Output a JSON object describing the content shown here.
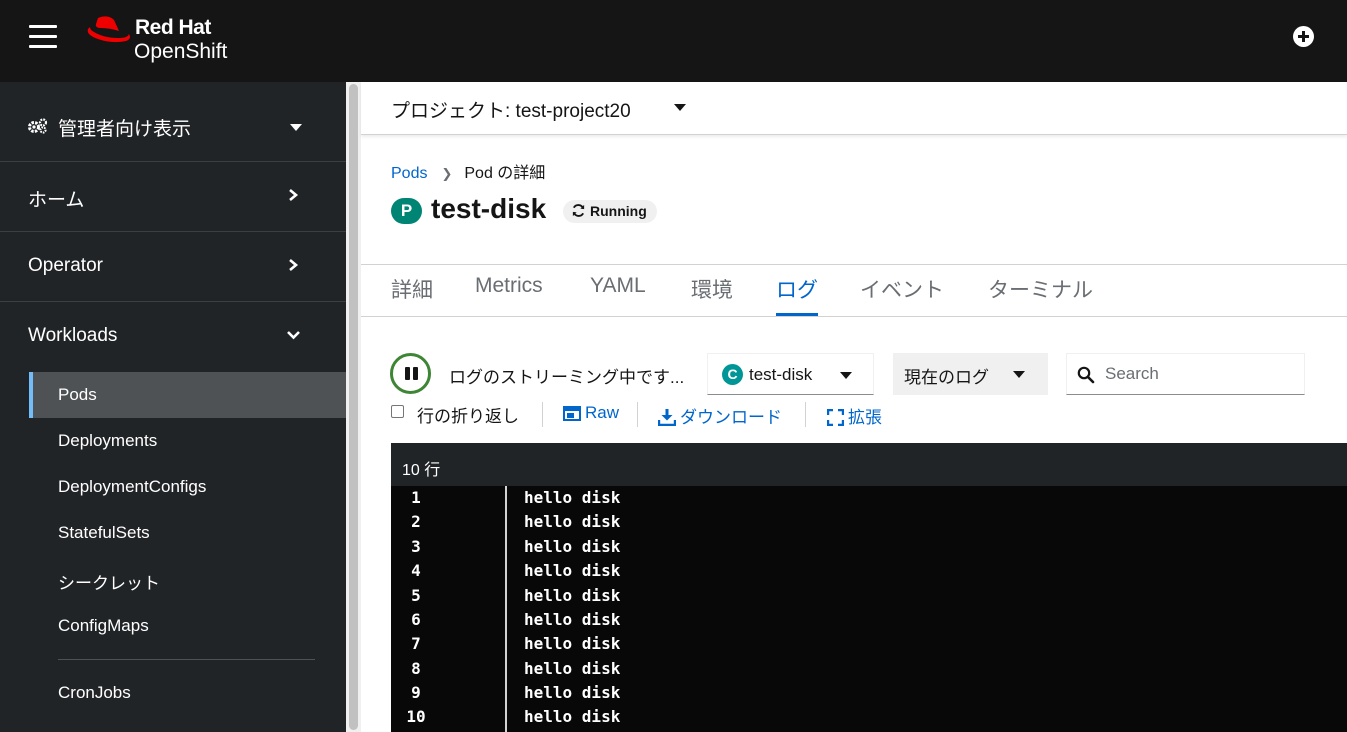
{
  "masthead": {
    "brand_line1": "Red Hat",
    "brand_line2": "OpenShift"
  },
  "sidebar": {
    "perspective": "管理者向け表示",
    "sections": [
      {
        "label": "ホーム"
      },
      {
        "label": "Operator"
      },
      {
        "label": "Workloads"
      }
    ],
    "workloads_items": [
      {
        "label": "Pods",
        "active": true
      },
      {
        "label": "Deployments"
      },
      {
        "label": "DeploymentConfigs"
      },
      {
        "label": "StatefulSets"
      },
      {
        "label": "シークレット"
      },
      {
        "label": "ConfigMaps"
      },
      {
        "label": "CronJobs"
      }
    ]
  },
  "project": {
    "label": "プロジェクト: test-project20"
  },
  "breadcrumb": {
    "parent": "Pods",
    "current": "Pod の詳細"
  },
  "pod": {
    "badge": "P",
    "name": "test-disk",
    "status": "Running"
  },
  "tabs": [
    {
      "label": "詳細"
    },
    {
      "label": "Metrics"
    },
    {
      "label": "YAML"
    },
    {
      "label": "環境"
    },
    {
      "label": "ログ",
      "active": true
    },
    {
      "label": "イベント"
    },
    {
      "label": "ターミナル"
    }
  ],
  "log_toolbar": {
    "streaming_text": "ログのストリーミング中です...",
    "container_badge": "C",
    "container": "test-disk",
    "log_type": "現在のログ",
    "search_placeholder": "Search",
    "wrap_label": "行の折り返し",
    "raw_label": "Raw",
    "download_label": "ダウンロード",
    "expand_label": "拡張"
  },
  "log_viewer": {
    "line_count": "10 行",
    "lines": [
      {
        "num": "1",
        "text": "hello disk"
      },
      {
        "num": "2",
        "text": "hello disk"
      },
      {
        "num": "3",
        "text": "hello disk"
      },
      {
        "num": "4",
        "text": "hello disk"
      },
      {
        "num": "5",
        "text": "hello disk"
      },
      {
        "num": "6",
        "text": "hello disk"
      },
      {
        "num": "7",
        "text": "hello disk"
      },
      {
        "num": "8",
        "text": "hello disk"
      },
      {
        "num": "9",
        "text": "hello disk"
      },
      {
        "num": "10",
        "text": "hello disk"
      }
    ]
  },
  "colors": {
    "masthead": "#151515",
    "sidebar": "#212427",
    "link": "#0066cc",
    "pod_badge": "#008474",
    "container_badge": "#009596",
    "streaming_ring": "#3e8635",
    "brand_red": "#ee0000"
  }
}
